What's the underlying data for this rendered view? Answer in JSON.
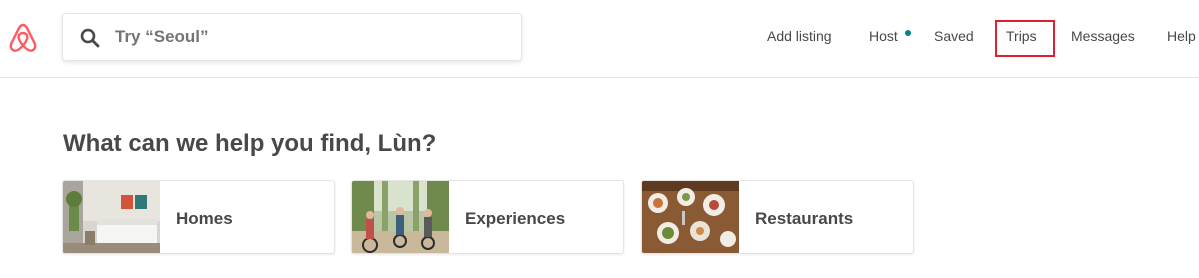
{
  "colors": {
    "brand": "#FF5A5F",
    "notification_dot": "#008489",
    "highlight": "#E0202E",
    "text": "#484848"
  },
  "header": {
    "logo_icon": "airbnb-belo-logo",
    "search": {
      "icon": "search-icon",
      "value": "",
      "placeholder": "Try “Seoul”"
    },
    "nav": {
      "add_listing": "Add listing",
      "host": "Host",
      "saved": "Saved",
      "trips": "Trips",
      "messages": "Messages",
      "help": "Help"
    }
  },
  "main": {
    "heading": "What can we help you find, Lùn?",
    "categories": [
      {
        "label": "Homes",
        "image": "bedroom-photo"
      },
      {
        "label": "Experiences",
        "image": "cyclists-photo"
      },
      {
        "label": "Restaurants",
        "image": "dining-table-photo"
      }
    ]
  }
}
